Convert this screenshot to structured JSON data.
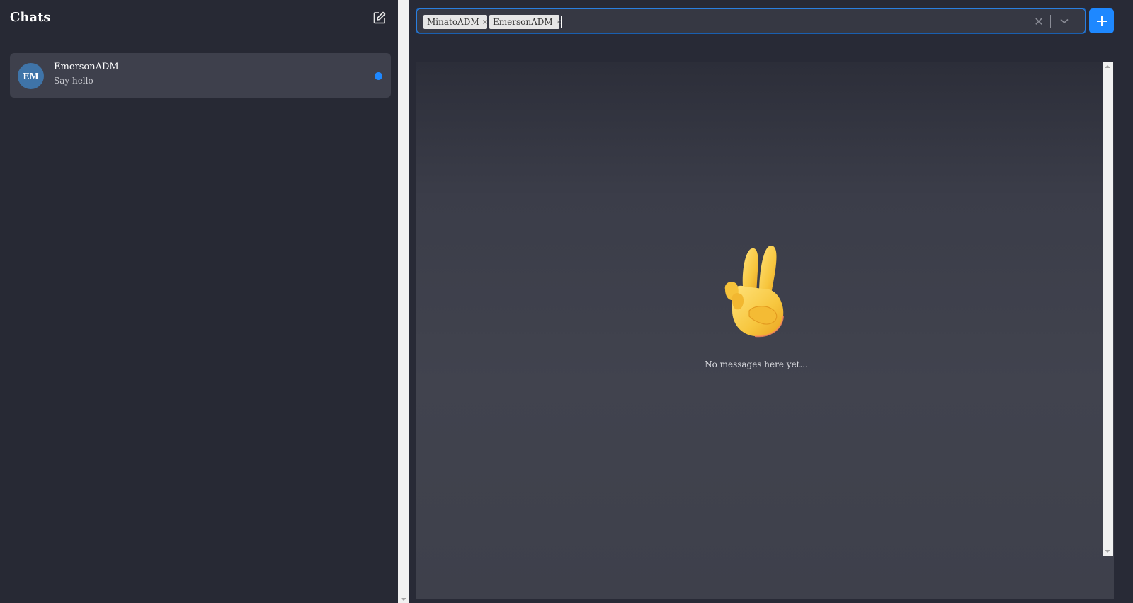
{
  "sidebar": {
    "title": "Chats",
    "compose_icon": "edit-square-icon",
    "chats": [
      {
        "initials": "EM",
        "name": "EmersonADM",
        "preview": "Say hello",
        "unread": true
      }
    ]
  },
  "recipients": {
    "chips": [
      {
        "label": "MinatoADM",
        "remove": "×"
      },
      {
        "label": "EmersonADM",
        "remove": "×"
      }
    ],
    "clear_glyph": "✕",
    "add_glyph": "+"
  },
  "messages": {
    "empty_emoji": "victory-hand-icon",
    "empty_text": "No messages here yet..."
  },
  "colors": {
    "accent": "#1e88ff",
    "background": "#282a36",
    "panel": "#3e404c"
  }
}
